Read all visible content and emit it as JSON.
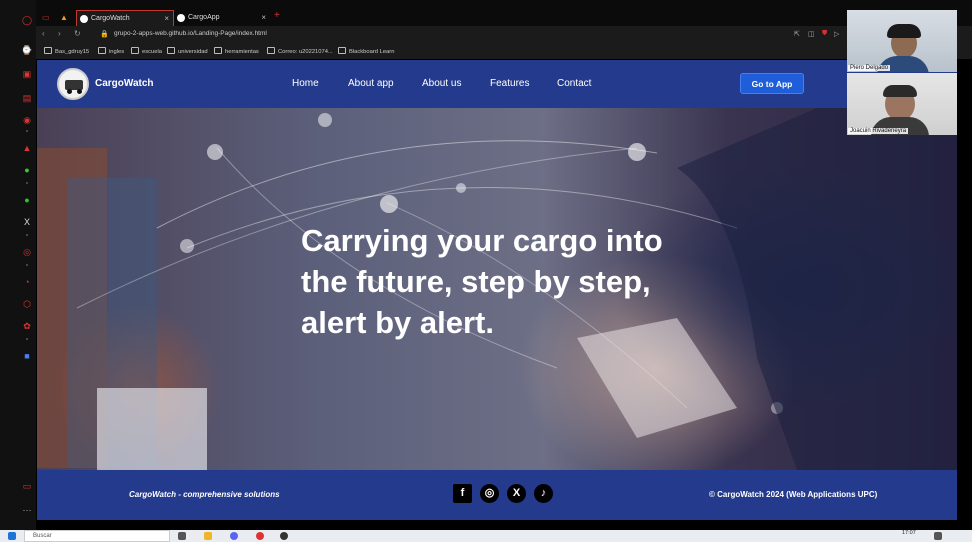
{
  "browser": {
    "tabs": [
      {
        "label": "CargoWatch",
        "active": true
      },
      {
        "label": "CargoApp",
        "active": false
      }
    ],
    "new_tab": "+",
    "close_glyph": "×",
    "url": "grupo-2-apps-web.github.io/Landing-Page/index.html",
    "bookmarks": [
      "Bas_gdruy15",
      "ingles",
      "escuela",
      "universidad",
      "herramientas",
      "Correo: u20221074...",
      "Blackboard Learn"
    ]
  },
  "site": {
    "brand": "CargoWatch",
    "nav": [
      "Home",
      "About app",
      "About us",
      "Features",
      "Contact"
    ],
    "cta": "Go to App",
    "hero_title": "Carrying your cargo into the future, step by step, alert by alert.",
    "footer_tagline": "CargoWatch - comprehensive solutions",
    "footer_copyright": "© CargoWatch 2024 (Web Applications UPC)",
    "social_icons": [
      "facebook-icon",
      "instagram-icon",
      "x-icon",
      "tiktok-icon"
    ],
    "social_glyphs": [
      "f",
      "◎",
      "X",
      "♪"
    ]
  },
  "call": {
    "participants": [
      "Piero Delgado",
      "Joacuin Rivadeneyra"
    ]
  },
  "taskbar": {
    "search_placeholder": "Buscar",
    "time": "17:07"
  },
  "colors": {
    "header_blue": "#243a8c",
    "cta_blue": "#1e5ed8",
    "browser_accent": "#c0392b"
  }
}
